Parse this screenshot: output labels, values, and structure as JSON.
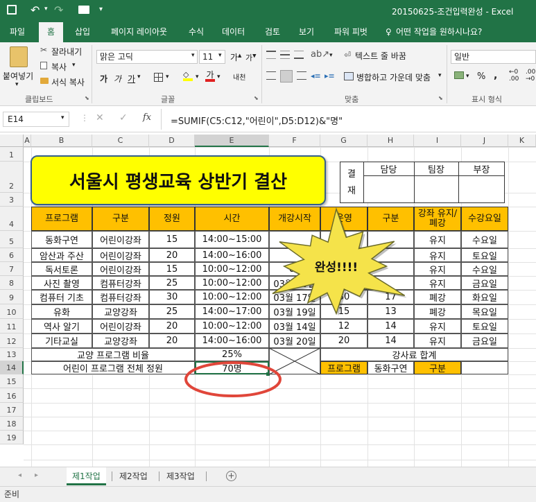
{
  "titlebar": {
    "title": "20150625-조건입력완성 - Excel"
  },
  "tabs": [
    "파일",
    "홈",
    "삽입",
    "페이지 레이아웃",
    "수식",
    "데이터",
    "검토",
    "보기",
    "파워 피벗"
  ],
  "tell_me": "어떤 작업을 원하시나요?",
  "ribbon": {
    "clipboard": {
      "paste": "붙여넣기",
      "cut": "잘라내기",
      "copy": "복사",
      "format_painter": "서식 복사",
      "label": "클립보드"
    },
    "font": {
      "name": "맑은 고딕",
      "size": "11",
      "bold": "가",
      "italic": "가",
      "underline": "가",
      "label": "글꼴"
    },
    "align": {
      "wrap": "텍스트 줄 바꿈",
      "merge": "병합하고 가운데 맞춤",
      "label": "맞춤"
    },
    "number": {
      "format": "일반",
      "percent": "%",
      "comma": ",",
      "label": "표시 형식"
    }
  },
  "formula_bar": {
    "name_box": "E14",
    "fx": "fx",
    "formula": "=SUMIF(C5:C12,\"어린이\",D5:D12)&\"명\""
  },
  "columns": [
    "A",
    "B",
    "C",
    "D",
    "E",
    "F",
    "G",
    "H",
    "I",
    "J",
    "K"
  ],
  "rows": [
    "1",
    "2",
    "3",
    "4",
    "5",
    "6",
    "7",
    "8",
    "9",
    "10",
    "11",
    "12",
    "13",
    "14",
    "15",
    "16",
    "17",
    "18",
    "19"
  ],
  "sheet": {
    "title": "서울시 평생교육 상반기 결산",
    "approval": {
      "label1": "결",
      "label2": "재",
      "h1": "담당",
      "h2": "팀장",
      "h3": "부장"
    },
    "headers": [
      "프로그램",
      "구분",
      "정원",
      "시간",
      "개강시작",
      "운영",
      "구분",
      "강좌 유지/폐강",
      "수강요일"
    ],
    "rows": [
      {
        "c": [
          "동화구연",
          "어린이강좌",
          "15",
          "14:00~15:00",
          "",
          "",
          "",
          "유지",
          "수요일"
        ]
      },
      {
        "c": [
          "암산과 주산",
          "어린이강좌",
          "20",
          "14:00~16:00",
          "",
          "",
          "",
          "유지",
          "토요일"
        ]
      },
      {
        "c": [
          "독서토론",
          "어린이강좌",
          "15",
          "10:00~12:00",
          "03",
          "",
          "",
          "유지",
          "수요일"
        ]
      },
      {
        "c": [
          "사진 촬영",
          "컴퓨터강좌",
          "25",
          "10:00~12:00",
          "03월 20일",
          "",
          "",
          "유지",
          "금요일"
        ]
      },
      {
        "c": [
          "컴퓨터 기초",
          "컴퓨터강좌",
          "30",
          "10:00~12:00",
          "03월 17일",
          "30",
          "17",
          "폐강",
          "화요일"
        ]
      },
      {
        "c": [
          "유화",
          "교양강좌",
          "25",
          "14:00~17:00",
          "03월 19일",
          "15",
          "13",
          "폐강",
          "목요일"
        ]
      },
      {
        "c": [
          "역사 알기",
          "어린이강좌",
          "20",
          "10:00~12:00",
          "03월 14일",
          "12",
          "14",
          "유지",
          "토요일"
        ]
      },
      {
        "c": [
          "기타교실",
          "교양강좌",
          "20",
          "14:00~16:00",
          "03월 20일",
          "20",
          "14",
          "유지",
          "금요일"
        ]
      }
    ],
    "r13": {
      "label": "교양 프로그램 비율",
      "value": "25%",
      "right": "강사료 합계"
    },
    "r14": {
      "label": "어린이 프로그램 전체 정원",
      "value": "70명",
      "g": "프로그램",
      "h": "동화구연",
      "i": "구분"
    },
    "burst": "완성!!!!"
  },
  "sheet_tabs": [
    "제1작업",
    "제2작업",
    "제3작업"
  ],
  "status": "준비",
  "colors": {
    "excel_green": "#217346",
    "header_fill": "#ffc000",
    "title_fill": "#ffff00",
    "burst_fill": "#f5e34a",
    "circle": "#e0463a"
  }
}
